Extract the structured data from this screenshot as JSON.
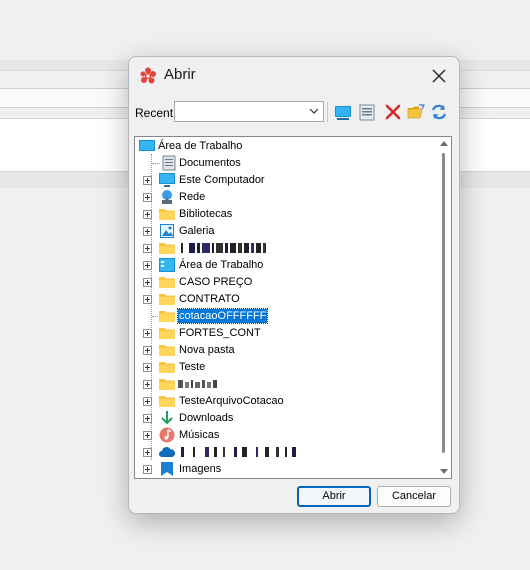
{
  "dialog": {
    "title": "Abrir",
    "recent_label": "Recent:",
    "recent_value": "",
    "open_button": "Abrir",
    "cancel_button": "Cancelar"
  },
  "tree": {
    "root": "Área de Trabalho",
    "items": [
      {
        "label": "Documentos",
        "icon": "document-icon",
        "expander": false
      },
      {
        "label": "Este Computador",
        "icon": "computer-icon",
        "expander": true
      },
      {
        "label": "Rede",
        "icon": "network-icon",
        "expander": true
      },
      {
        "label": "Bibliotecas",
        "icon": "folder-icon",
        "expander": true
      },
      {
        "label": "Galeria",
        "icon": "gallery-icon",
        "expander": true
      },
      {
        "label": "",
        "icon": "folder-icon",
        "expander": true,
        "redacted": true
      },
      {
        "label": "Área de Trabalho",
        "icon": "desktop-icon",
        "expander": true
      },
      {
        "label": "CASO PREÇO",
        "icon": "folder-icon",
        "expander": true
      },
      {
        "label": "CONTRATO",
        "icon": "folder-icon",
        "expander": true
      },
      {
        "label": "cotacaoOFFFFFF",
        "icon": "folder-icon",
        "expander": false,
        "selected": true
      },
      {
        "label": "FORTES_CONT",
        "icon": "folder-icon",
        "expander": true
      },
      {
        "label": "Nova pasta",
        "icon": "folder-icon",
        "expander": true
      },
      {
        "label": "Teste",
        "icon": "folder-icon",
        "expander": true
      },
      {
        "label": "",
        "icon": "folder-icon",
        "expander": true,
        "redacted": true
      },
      {
        "label": "TesteArquivoCotacao",
        "icon": "folder-icon",
        "expander": true
      },
      {
        "label": "Downloads",
        "icon": "download-icon",
        "expander": true
      },
      {
        "label": "Músicas",
        "icon": "music-icon",
        "expander": true
      },
      {
        "label": "",
        "icon": "cloud-icon",
        "expander": true,
        "redacted": true
      },
      {
        "label": "Imagens",
        "icon": "pictures-icon",
        "expander": true
      }
    ]
  },
  "colors": {
    "selection": "#0078d7",
    "folder": "#ffd65a",
    "accent": "#0067c0"
  }
}
